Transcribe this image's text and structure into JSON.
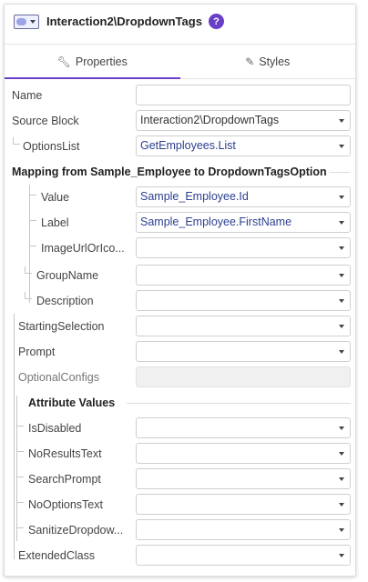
{
  "header": {
    "title": "Interaction2\\DropdownTags",
    "help": "?"
  },
  "tabs": [
    {
      "label": "Properties"
    },
    {
      "label": "Styles"
    }
  ],
  "fields": {
    "name": {
      "label": "Name",
      "value": ""
    },
    "source_block": {
      "label": "Source Block",
      "value": "Interaction2\\DropdownTags"
    },
    "options_list": {
      "label": "OptionsList",
      "value": "GetEmployees.List"
    }
  },
  "mapping": {
    "title": "Mapping from Sample_Employee to DropdownTagsOption",
    "value": {
      "label": "Value",
      "value": "Sample_Employee.Id"
    },
    "label": {
      "label": "Label",
      "value": "Sample_Employee.FirstName"
    },
    "image_url": {
      "label": "ImageUrlOrIco...",
      "value": ""
    },
    "group_name": {
      "label": "GroupName",
      "value": ""
    },
    "description": {
      "label": "Description",
      "value": ""
    }
  },
  "more_fields": {
    "starting_selection": {
      "label": "StartingSelection",
      "value": ""
    },
    "prompt": {
      "label": "Prompt",
      "value": ""
    },
    "optional_configs": {
      "label": "OptionalConfigs",
      "value": ""
    }
  },
  "attributes": {
    "title": "Attribute Values",
    "is_disabled": {
      "label": "IsDisabled",
      "value": ""
    },
    "no_results_text": {
      "label": "NoResultsText",
      "value": ""
    },
    "search_prompt": {
      "label": "SearchPrompt",
      "value": ""
    },
    "no_options_text": {
      "label": "NoOptionsText",
      "value": ""
    },
    "sanitize": {
      "label": "SanitizeDropdow...",
      "value": ""
    }
  },
  "extended_class": {
    "label": "ExtendedClass",
    "value": ""
  },
  "colors": {
    "accent": "#6a3fc8",
    "value_text": "#2c3f8f"
  }
}
